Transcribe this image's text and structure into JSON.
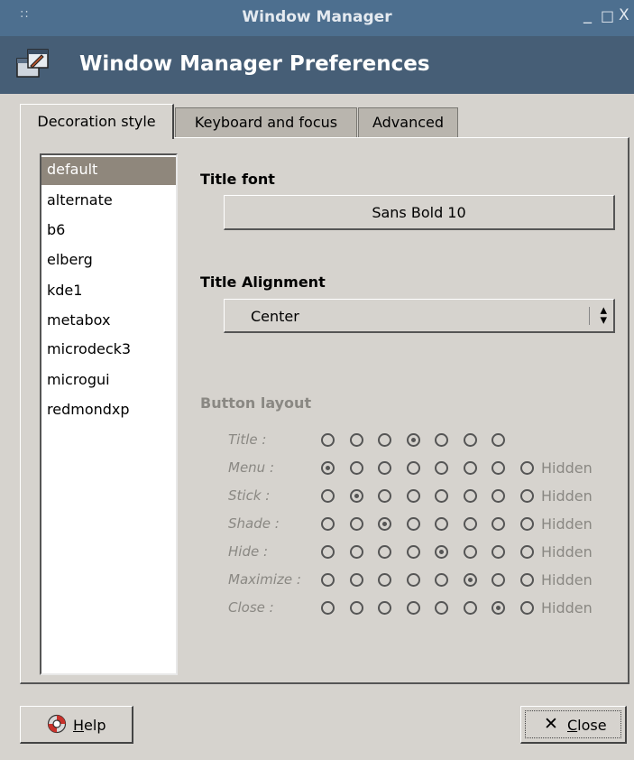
{
  "window": {
    "title": "Window Manager",
    "controls": {
      "minimize": "_",
      "maximize": "□",
      "close": "X"
    }
  },
  "header": {
    "title": "Window Manager Preferences",
    "icon": "window-manager-icon"
  },
  "tabs": [
    {
      "label": "Decoration style",
      "active": true
    },
    {
      "label": "Keyboard and focus",
      "active": false
    },
    {
      "label": "Advanced",
      "active": false
    }
  ],
  "styles": {
    "selected": "default",
    "items": [
      "default",
      "alternate",
      "b6",
      "elberg",
      "kde1",
      "metabox",
      "microdeck3",
      "microgui",
      "redmondxp"
    ]
  },
  "title_font": {
    "label": "Title font",
    "value": "Sans Bold 10"
  },
  "title_alignment": {
    "label": "Title Alignment",
    "value": "Center"
  },
  "button_layout": {
    "label": "Button layout",
    "hidden_label": "Hidden",
    "rows": [
      {
        "label": "Title :",
        "selected": 4,
        "options": 7,
        "hidden": false
      },
      {
        "label": "Menu :",
        "selected": 1,
        "options": 8,
        "hidden": true
      },
      {
        "label": "Stick :",
        "selected": 2,
        "options": 8,
        "hidden": true
      },
      {
        "label": "Shade :",
        "selected": 3,
        "options": 8,
        "hidden": true
      },
      {
        "label": "Hide :",
        "selected": 5,
        "options": 8,
        "hidden": true
      },
      {
        "label": "Maximize :",
        "selected": 6,
        "options": 8,
        "hidden": true
      },
      {
        "label": "Close :",
        "selected": 7,
        "options": 8,
        "hidden": true
      }
    ]
  },
  "buttons": {
    "help": "Help",
    "help_icon": "lifebuoy-icon",
    "close": "Close",
    "close_icon": "close-x-icon"
  }
}
